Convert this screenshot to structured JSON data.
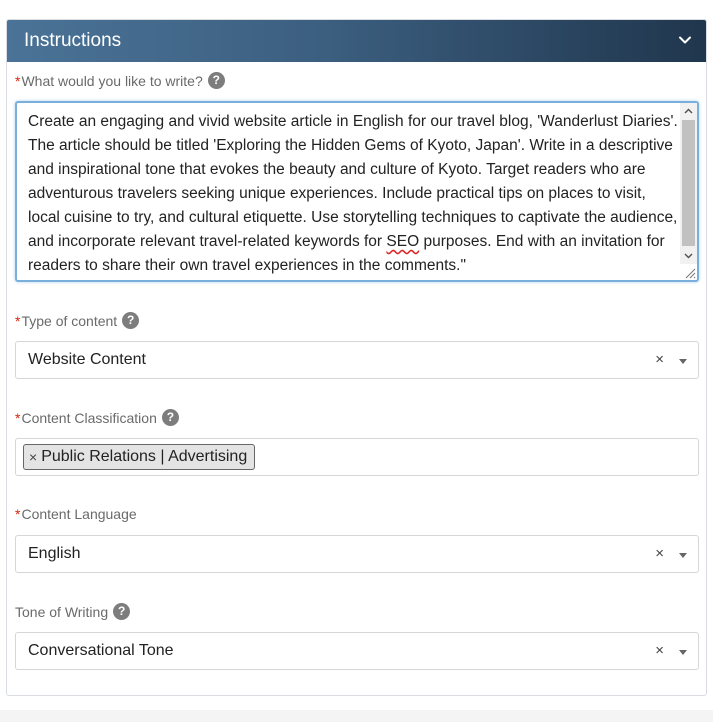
{
  "panel": {
    "title": "Instructions"
  },
  "prompt_field": {
    "required_mark": "*",
    "label": "What would you like to write?",
    "help": "?",
    "text_part1": "Create an engaging and vivid website article in English for our travel blog, 'Wanderlust Diaries'. The article should be titled 'Exploring the Hidden Gems of Kyoto, Japan'. Write in a descriptive and inspirational tone that evokes the beauty and culture of Kyoto. Target readers who are adventurous travelers seeking unique experiences. Include practical tips on places to visit, local cuisine to try, and cultural etiquette. Use storytelling techniques to captivate the audience, and incorporate relevant travel-related keywords for ",
    "text_seo": "SEO",
    "text_part2": " purposes. End with an invitation for readers to share their own travel experiences in the comments.\""
  },
  "type_of_content": {
    "required_mark": "*",
    "label": "Type of content",
    "help": "?",
    "value": "Website Content",
    "clear": "×"
  },
  "content_classification": {
    "required_mark": "*",
    "label": "Content Classification",
    "help": "?",
    "tag_remove": "×",
    "tag": "Public Relations | Advertising"
  },
  "content_language": {
    "required_mark": "*",
    "label": "Content Language",
    "value": "English",
    "clear": "×"
  },
  "tone_of_writing": {
    "label": "Tone of Writing",
    "help": "?",
    "value": "Conversational Tone",
    "clear": "×"
  },
  "colors": {
    "header_start": "#4a7397",
    "header_end": "#20364d",
    "required": "#d9230f",
    "focus_border": "#7aaedb"
  }
}
